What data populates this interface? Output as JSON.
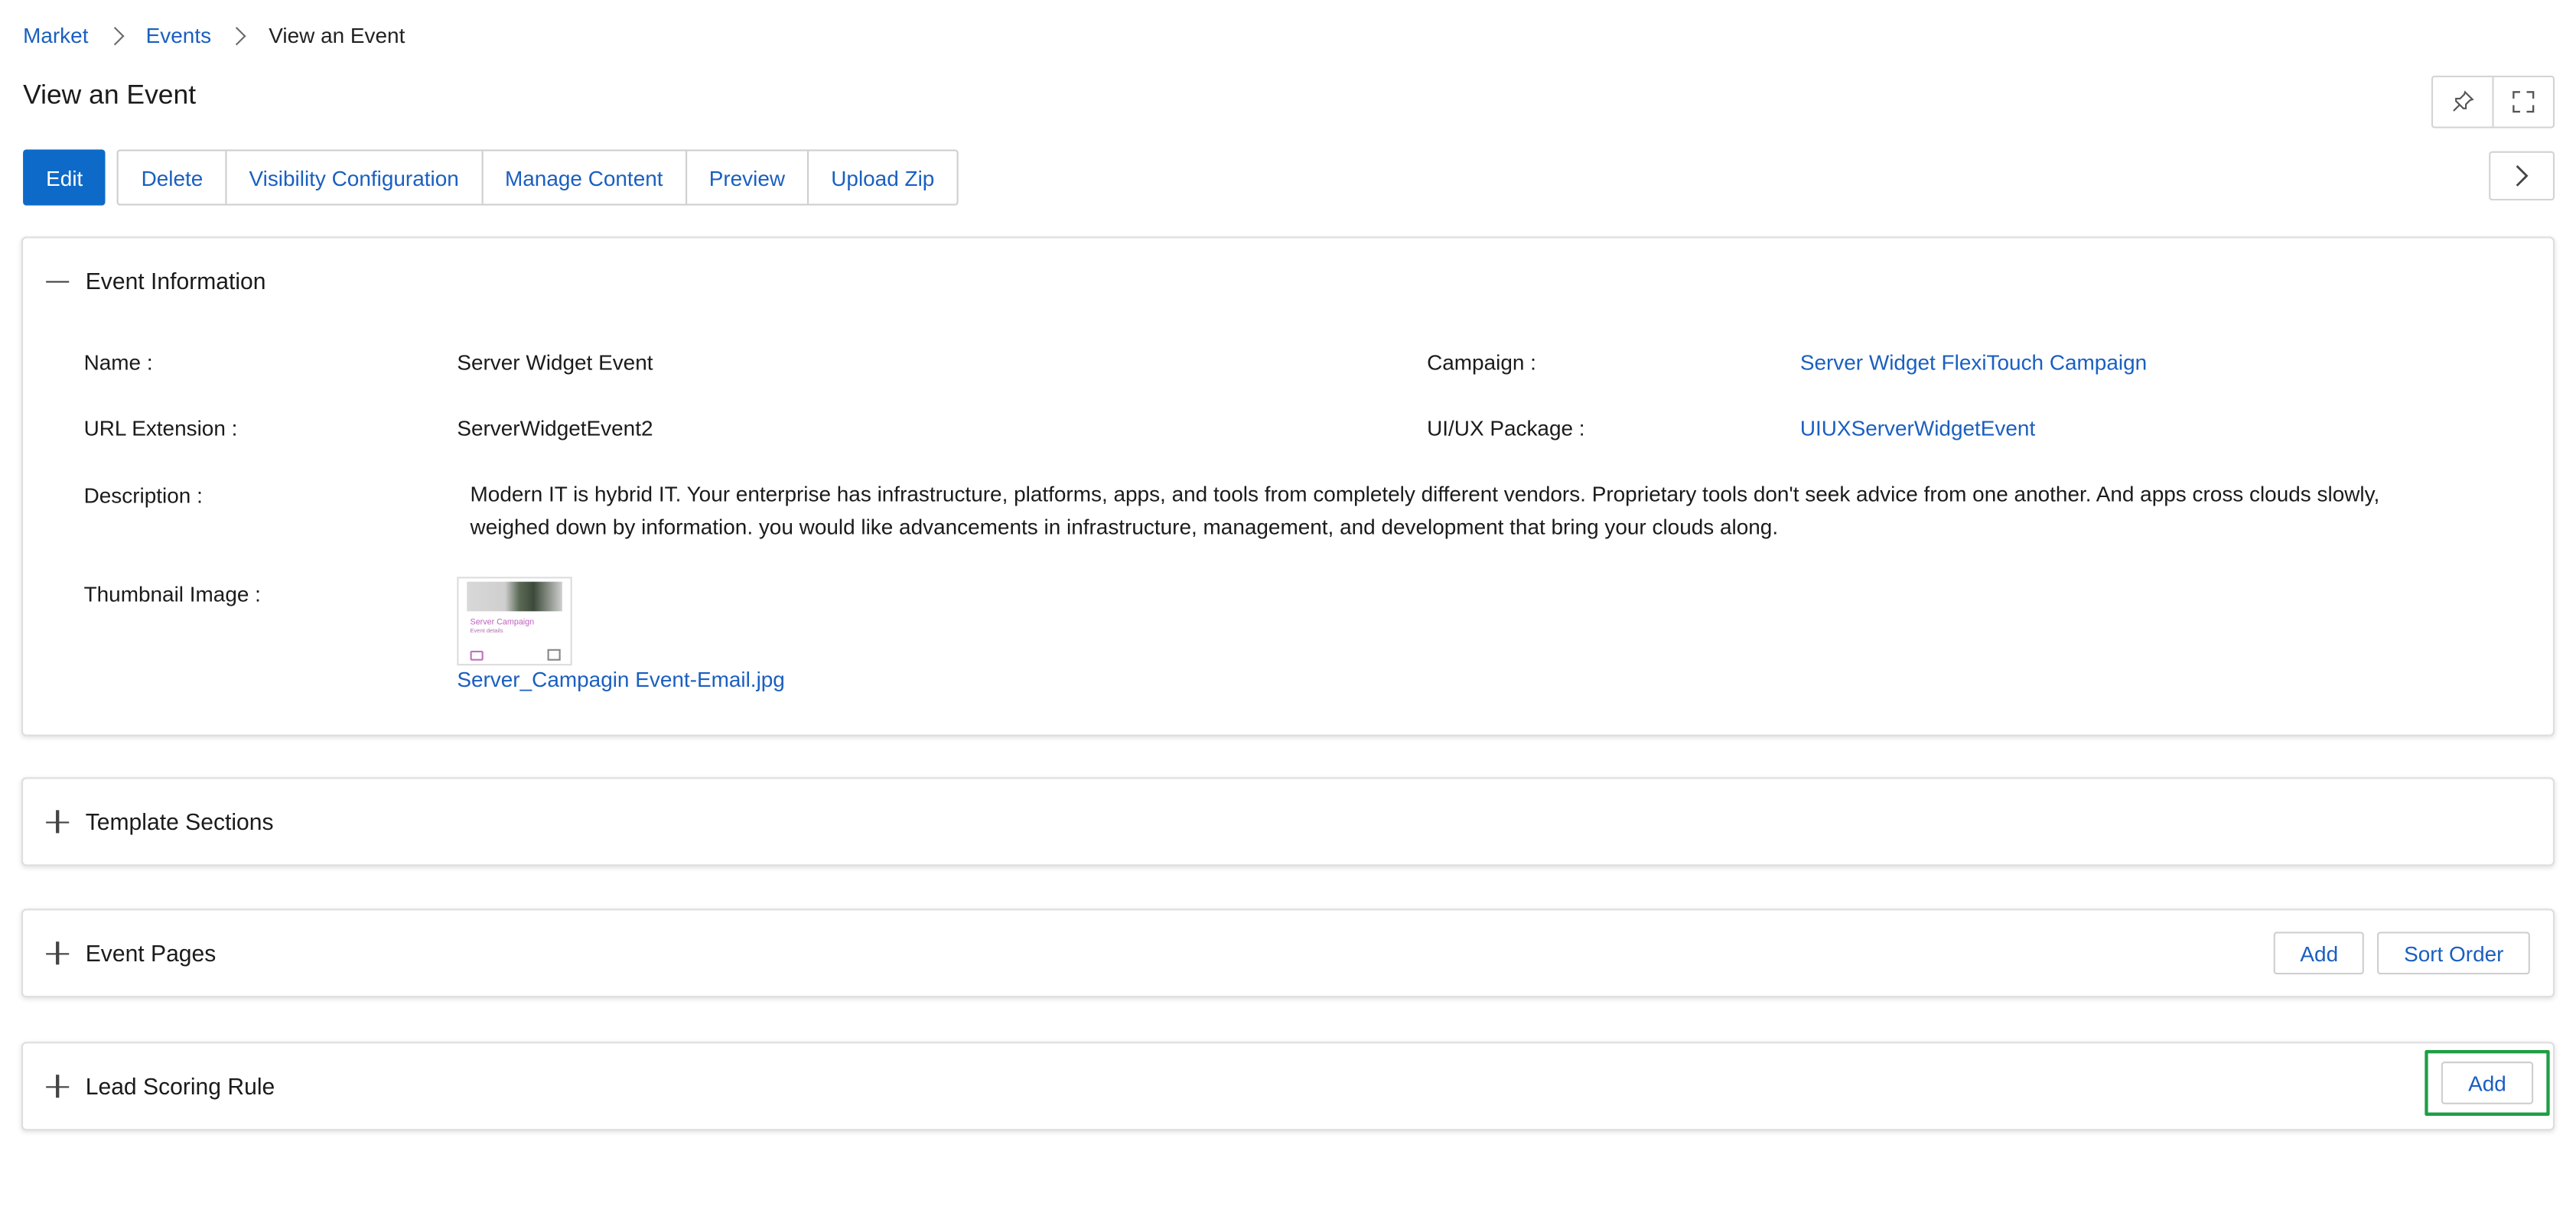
{
  "breadcrumb": {
    "items": [
      "Market",
      "Events"
    ],
    "current": "View an Event"
  },
  "page_title": "View an Event",
  "toolbar": {
    "edit": "Edit",
    "buttons": [
      "Delete",
      "Visibility Configuration",
      "Manage Content",
      "Preview",
      "Upload Zip"
    ]
  },
  "event_info": {
    "heading": "Event Information",
    "name_label": "Name :",
    "name_value": "Server Widget Event",
    "campaign_label": "Campaign :",
    "campaign_value": "Server Widget FlexiTouch Campaign",
    "url_label": "URL Extension :",
    "url_value": "ServerWidgetEvent2",
    "uiux_label": "UI/UX Package :",
    "uiux_value": "UIUXServerWidgetEvent",
    "description_label": "Description :",
    "description_value": "Modern IT is hybrid IT. Your enterprise has infrastructure, platforms, apps, and tools from completely different vendors. Proprietary tools don't seek advice from one another. And apps cross clouds slowly, weighed down by information. you would like advancements in infrastructure, management, and development that bring your clouds along.",
    "thumbnail_label": "Thumbnail Image :",
    "thumbnail_file": "Server_Campagin Event-Email.jpg",
    "thumbnail_text": "Server Campaign",
    "thumbnail_subtext": "Event details"
  },
  "template_sections": {
    "heading": "Template Sections"
  },
  "event_pages": {
    "heading": "Event Pages",
    "add": "Add",
    "sort": "Sort Order"
  },
  "lead_scoring": {
    "heading": "Lead Scoring Rule",
    "add": "Add"
  },
  "icons": [
    "pin-icon",
    "fullscreen-icon",
    "chevron-right-icon",
    "collapse-icon",
    "expand-icon"
  ],
  "colors": {
    "primary": "#0e6ac9",
    "link": "#1a5fc0",
    "highlight": "#1f9e45"
  }
}
